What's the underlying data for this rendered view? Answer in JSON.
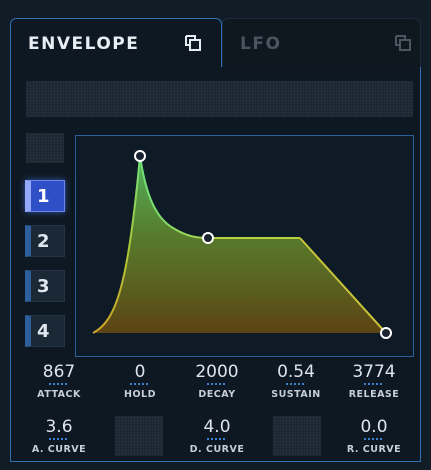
{
  "tabs": [
    {
      "label": "ENVELOPE",
      "icon": "popout-icon",
      "active": true
    },
    {
      "label": "LFO",
      "icon": "popout-icon",
      "active": false
    }
  ],
  "slots": [
    "1",
    "2",
    "3",
    "4"
  ],
  "selected_slot": "1",
  "params_row1": [
    {
      "value": "867",
      "label": "ATTACK"
    },
    {
      "value": "0",
      "label": "HOLD"
    },
    {
      "value": "2000",
      "label": "DECAY"
    },
    {
      "value": "0.54",
      "label": "SUSTAIN"
    },
    {
      "value": "3774",
      "label": "RELEASE"
    }
  ],
  "params_row2": [
    {
      "value": "3.6",
      "label": "A. CURVE"
    },
    {
      "value": "4.0",
      "label": "D. CURVE"
    },
    {
      "value": "0.0",
      "label": "R. CURVE"
    }
  ],
  "colors": {
    "accent": "#2f6fb4",
    "active_slot": "#2e4fc5",
    "curve_attack": "#c8b22a",
    "curve_peak": "#5fd36a",
    "curve_sustain": "#b7cf3c"
  }
}
